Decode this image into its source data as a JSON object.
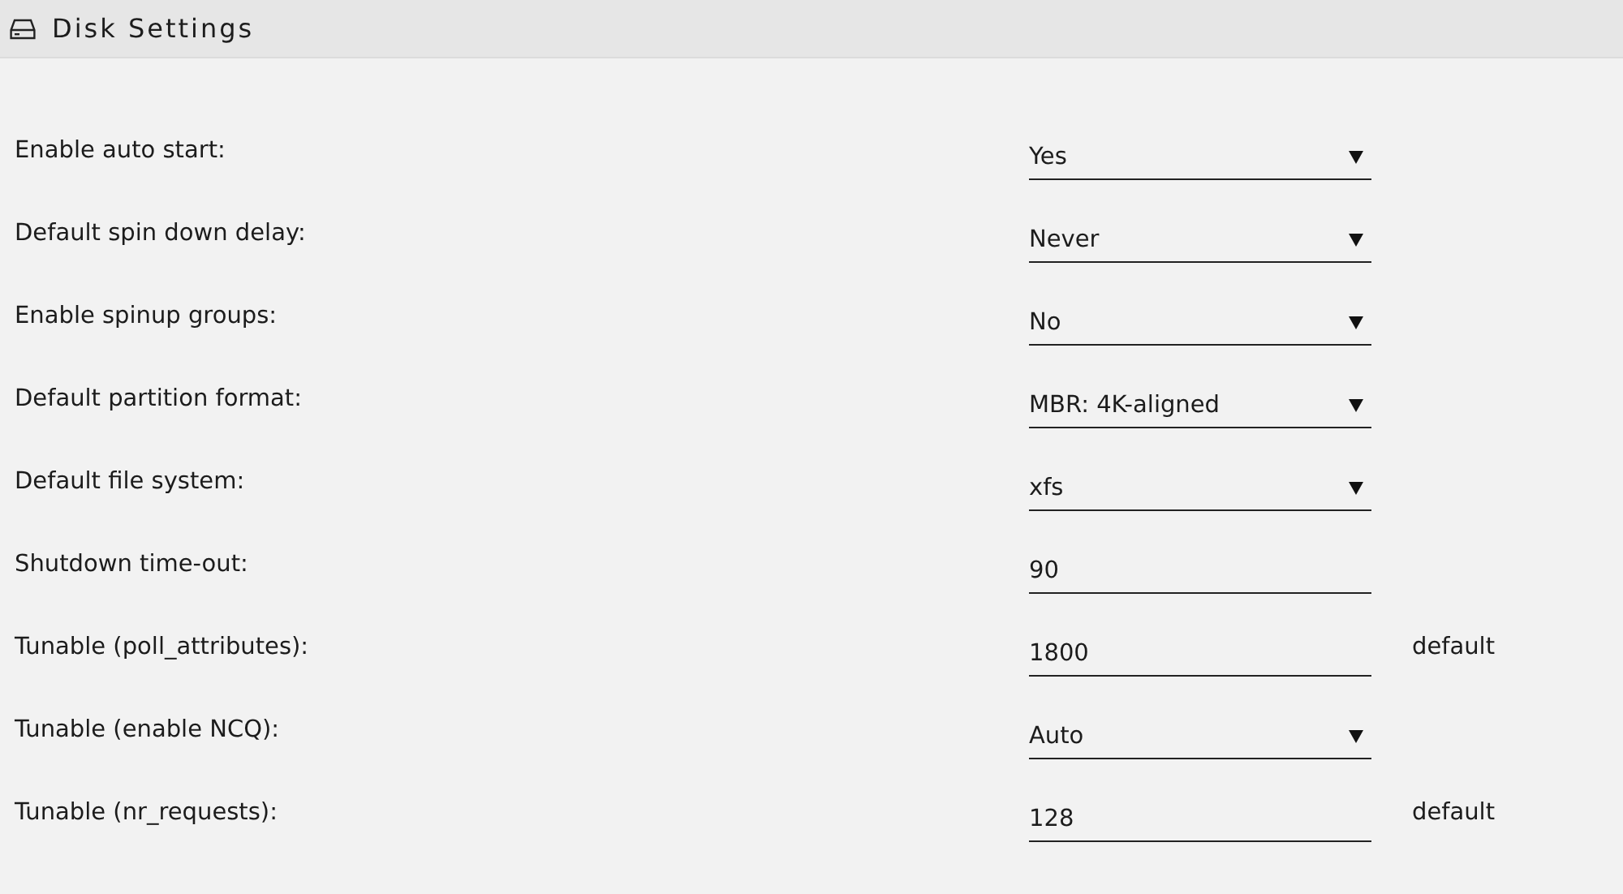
{
  "header": {
    "title": "Disk Settings"
  },
  "settings": [
    {
      "label": "Enable auto start:",
      "kind": "select",
      "value": "Yes"
    },
    {
      "label": "Default spin down delay:",
      "kind": "select",
      "value": "Never"
    },
    {
      "label": "Enable spinup groups:",
      "kind": "select",
      "value": "No"
    },
    {
      "label": "Default partition format:",
      "kind": "select",
      "value": "MBR: 4K-aligned"
    },
    {
      "label": "Default file system:",
      "kind": "select",
      "value": "xfs"
    },
    {
      "label": "Shutdown time-out:",
      "kind": "input",
      "value": "90"
    },
    {
      "label": "Tunable (poll_attributes):",
      "kind": "input",
      "value": "1800",
      "note": "default"
    },
    {
      "label": "Tunable (enable NCQ):",
      "kind": "select",
      "value": "Auto"
    },
    {
      "label": "Tunable (nr_requests):",
      "kind": "input",
      "value": "128",
      "note": "default"
    }
  ]
}
